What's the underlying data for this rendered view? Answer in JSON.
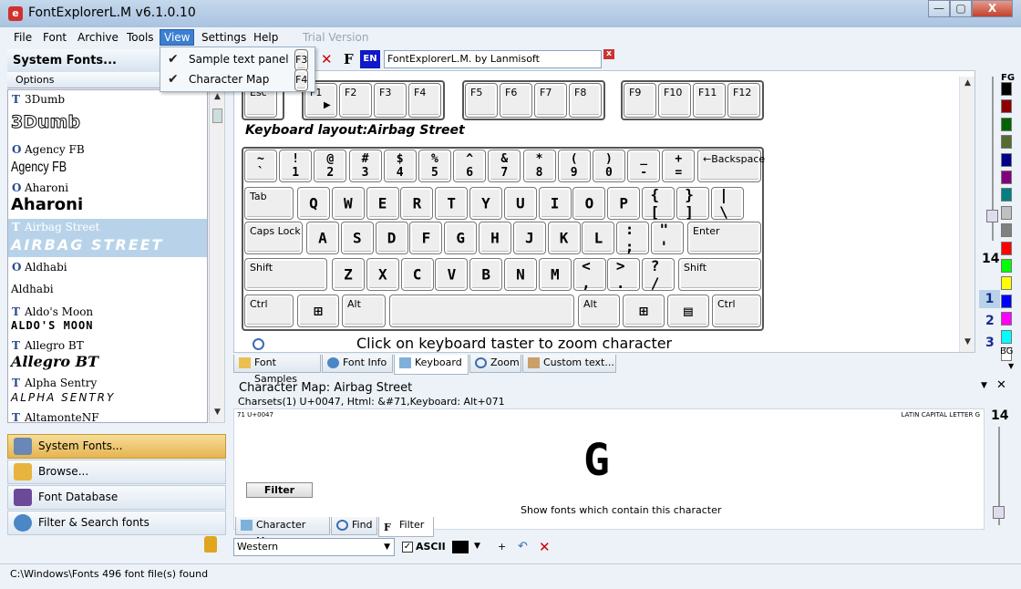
{
  "window": {
    "title": "FontExplorerL.M  v6.1.0.10",
    "min": "—",
    "max": "▢",
    "close": "X"
  },
  "menu": [
    "File",
    "Font",
    "Archive",
    "Tools",
    "View",
    "Settings",
    "Help",
    "Trial Version"
  ],
  "view_menu": {
    "items": [
      {
        "label": "Sample text panel",
        "shortcut": "F3",
        "checked": "✔"
      },
      {
        "label": "Character Map",
        "shortcut": "F4",
        "checked": "✔"
      }
    ]
  },
  "left": {
    "header": "System Fonts...",
    "options": "Options",
    "fonts": [
      {
        "type": "T",
        "name": "3Dumb",
        "sample": "3Dumb"
      },
      {
        "type": "O",
        "name": "Agency FB",
        "sample": "Agency FB"
      },
      {
        "type": "O",
        "name": "Aharoni",
        "sample": "Aharoni"
      },
      {
        "type": "T",
        "name": "Airbag Street",
        "sample": "AIRBAG STREET"
      },
      {
        "type": "O",
        "name": "Aldhabi",
        "sample": "Aldhabi"
      },
      {
        "type": "T",
        "name": "Aldo's Moon",
        "sample": "ALDO'S MOON"
      },
      {
        "type": "T",
        "name": "Allegro BT",
        "sample": "Allegro BT"
      },
      {
        "type": "T",
        "name": "Alpha Sentry",
        "sample": "ALPHA SENTRY"
      },
      {
        "type": "T",
        "name": "AltamonteNF",
        "sample": ""
      }
    ],
    "nav": [
      "System Fonts...",
      "Browse...",
      "Font Database",
      "Filter & Search fonts"
    ]
  },
  "toolbar": {
    "lang": "EN",
    "font_name": "FontExplorerL.M. by Lanmisoft",
    "clear": "x"
  },
  "keyboard": {
    "title": "Keyboard layout:Airbag Street",
    "hint": "Click on keyboard taster to zoom character",
    "fkeys": [
      "Esc",
      "F1",
      "F2",
      "F3",
      "F4",
      "F5",
      "F6",
      "F7",
      "F8",
      "F9",
      "F10",
      "F11",
      "F12"
    ],
    "row1": [
      [
        "~",
        "`"
      ],
      [
        "!",
        "1"
      ],
      [
        "@",
        "2"
      ],
      [
        "#",
        "3"
      ],
      [
        "$",
        "4"
      ],
      [
        "%",
        "5"
      ],
      [
        "^",
        "6"
      ],
      [
        "&",
        "7"
      ],
      [
        "*",
        "8"
      ],
      [
        "(",
        "9"
      ],
      [
        ")",
        "0"
      ],
      [
        "_",
        "-"
      ],
      [
        "+",
        "="
      ]
    ],
    "row1_end": "←Backspace",
    "row2_start": "Tab",
    "row2": [
      "Q",
      "W",
      "E",
      "R",
      "T",
      "Y",
      "U",
      "I",
      "O",
      "P",
      "{ [",
      "} ]",
      "| \\"
    ],
    "row3_start": "Caps Lock",
    "row3": [
      "A",
      "S",
      "D",
      "F",
      "G",
      "H",
      "J",
      "K",
      "L",
      ": ;",
      "\" '"
    ],
    "row3_end": "Enter",
    "row4_start": "Shift",
    "row4": [
      "Z",
      "X",
      "C",
      "V",
      "B",
      "N",
      "M",
      "< ,",
      "> .",
      "? /"
    ],
    "row4_end": "Shift",
    "row5": [
      "Ctrl",
      "⊞",
      "Alt",
      "",
      "Alt",
      "⊞",
      "▤",
      "Ctrl"
    ]
  },
  "tabs1": [
    "Font Samples",
    "Font Info",
    "Keyboard",
    "Zoom",
    "Custom text..."
  ],
  "charmap": {
    "title": "Character Map:  Airbag Street",
    "info": "Charsets(1)     U+0047, Html: &#71,Keyboard: Alt+071",
    "code": "71  U+0047",
    "desc": "LATIN CAPITAL LETTER G",
    "glyph": "G",
    "filter": "Filter",
    "hint": "Show fonts which contain this character",
    "size": "14"
  },
  "tabs2": [
    "Character Map",
    "Find",
    "Filter"
  ],
  "bottom": {
    "charset": "Western",
    "ascii": "ASCII"
  },
  "right": {
    "size": "14",
    "nums": [
      "1",
      "2",
      "3"
    ],
    "fg": "FG",
    "bg": "BG"
  },
  "colors": [
    "#000000",
    "#8b0000",
    "#006400",
    "#556b2f",
    "#00008b",
    "#800080",
    "#008080",
    "#c0c0c0",
    "#808080",
    "#ff0000",
    "#00ff00",
    "#ffff00",
    "#0000ff",
    "#ff00ff",
    "#00ffff",
    "#ffffff"
  ],
  "status": "C:\\Windows\\Fonts   496  font file(s) found"
}
